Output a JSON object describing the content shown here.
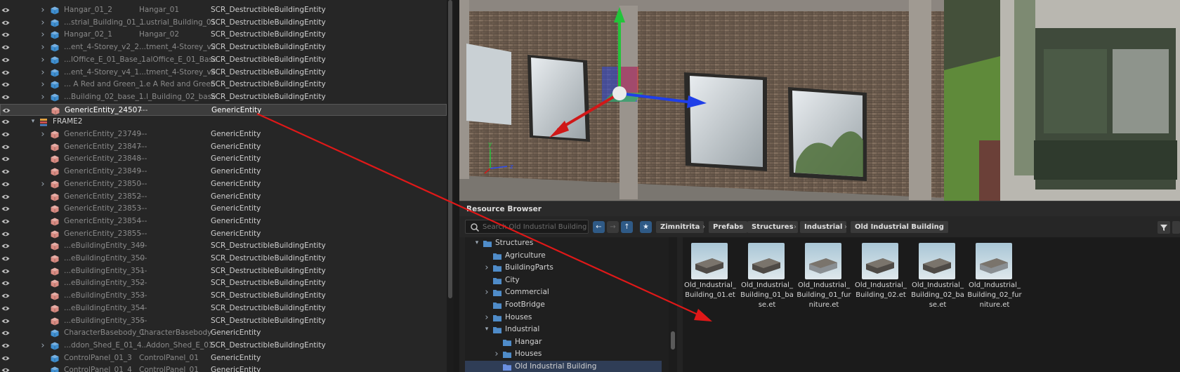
{
  "colors": {
    "accent_blue": "#2f5a86",
    "arrow_red": "#e01818",
    "entity_cube": "#d98b82",
    "prefab_cube": "#3f8fd1",
    "folder_blue": "#4f8cc9",
    "selection_row": "#3d3d3d"
  },
  "hierarchy": {
    "rows": [
      {
        "name": "Hangar_01_2",
        "prefab": "Hangar_01",
        "type": "SCR_DestructibleBuildingEntity",
        "icon": "prefab-cube-icon",
        "expandable": true,
        "dim": true
      },
      {
        "name": "...strial_Building_01_1",
        "prefab": "...ustrial_Building_01",
        "type": "SCR_DestructibleBuildingEntity",
        "icon": "prefab-cube-icon",
        "expandable": true,
        "dim": true
      },
      {
        "name": "Hangar_02_1",
        "prefab": "Hangar_02",
        "type": "SCR_DestructibleBuildingEntity",
        "icon": "prefab-cube-icon",
        "expandable": true,
        "dim": true
      },
      {
        "name": "...ent_4-Storey_v2_2",
        "prefab": "...tment_4-Storey_v2",
        "type": "SCR_DestructibleBuildingEntity",
        "icon": "prefab-cube-icon",
        "expandable": true,
        "dim": true
      },
      {
        "name": "...lOffice_E_01_Base_1",
        "prefab": "...alOffice_E_01_Base",
        "type": "SCR_DestructibleBuildingEntity",
        "icon": "prefab-cube-icon",
        "expandable": true,
        "dim": true
      },
      {
        "name": "...ent_4-Storey_v4_1",
        "prefab": "...tment_4-Storey_v4",
        "type": "SCR_DestructibleBuildingEntity",
        "icon": "prefab-cube-icon",
        "expandable": true,
        "dim": true
      },
      {
        "name": "... A Red and Green_1",
        "prefab": "...e A Red and Green",
        "type": "SCR_DestructibleBuildingEntity",
        "icon": "prefab-cube-icon",
        "expandable": true,
        "dim": true
      },
      {
        "name": "...Building_02_base_1",
        "prefab": "...l_Building_02_base",
        "type": "SCR_DestructibleBuildingEntity",
        "icon": "prefab-cube-icon",
        "expandable": true,
        "dim": true
      },
      {
        "name": "GenericEntity_24507",
        "prefab": "---",
        "type": "GenericEntity",
        "icon": "entity-cube-icon",
        "expandable": false,
        "dim": false,
        "selected": true
      },
      {
        "name": "FRAME2",
        "prefab": "",
        "type": "",
        "icon": "layer-icon",
        "expandable": true,
        "expanded": true,
        "dim": false,
        "layer": true
      },
      {
        "name": "GenericEntity_23749",
        "prefab": "---",
        "type": "GenericEntity",
        "icon": "entity-cube-icon",
        "expandable": true,
        "dim": true
      },
      {
        "name": "GenericEntity_23847",
        "prefab": "---",
        "type": "GenericEntity",
        "icon": "entity-cube-icon",
        "expandable": false,
        "dim": true
      },
      {
        "name": "GenericEntity_23848",
        "prefab": "---",
        "type": "GenericEntity",
        "icon": "entity-cube-icon",
        "expandable": false,
        "dim": true
      },
      {
        "name": "GenericEntity_23849",
        "prefab": "---",
        "type": "GenericEntity",
        "icon": "entity-cube-icon",
        "expandable": false,
        "dim": true
      },
      {
        "name": "GenericEntity_23850",
        "prefab": "---",
        "type": "GenericEntity",
        "icon": "entity-cube-icon",
        "expandable": true,
        "dim": true
      },
      {
        "name": "GenericEntity_23852",
        "prefab": "---",
        "type": "GenericEntity",
        "icon": "entity-cube-icon",
        "expandable": false,
        "dim": true
      },
      {
        "name": "GenericEntity_23853",
        "prefab": "---",
        "type": "GenericEntity",
        "icon": "entity-cube-icon",
        "expandable": false,
        "dim": true
      },
      {
        "name": "GenericEntity_23854",
        "prefab": "---",
        "type": "GenericEntity",
        "icon": "entity-cube-icon",
        "expandable": false,
        "dim": true
      },
      {
        "name": "GenericEntity_23855",
        "prefab": "---",
        "type": "GenericEntity",
        "icon": "entity-cube-icon",
        "expandable": false,
        "dim": true
      },
      {
        "name": "...eBuildingEntity_349",
        "prefab": "---",
        "type": "SCR_DestructibleBuildingEntity",
        "icon": "entity-cube-icon",
        "expandable": false,
        "dim": true
      },
      {
        "name": "...eBuildingEntity_350",
        "prefab": "---",
        "type": "SCR_DestructibleBuildingEntity",
        "icon": "entity-cube-icon",
        "expandable": false,
        "dim": true
      },
      {
        "name": "...eBuildingEntity_351",
        "prefab": "---",
        "type": "SCR_DestructibleBuildingEntity",
        "icon": "entity-cube-icon",
        "expandable": false,
        "dim": true
      },
      {
        "name": "...eBuildingEntity_352",
        "prefab": "---",
        "type": "SCR_DestructibleBuildingEntity",
        "icon": "entity-cube-icon",
        "expandable": false,
        "dim": true
      },
      {
        "name": "...eBuildingEntity_353",
        "prefab": "---",
        "type": "SCR_DestructibleBuildingEntity",
        "icon": "entity-cube-icon",
        "expandable": false,
        "dim": true
      },
      {
        "name": "...eBuildingEntity_354",
        "prefab": "---",
        "type": "SCR_DestructibleBuildingEntity",
        "icon": "entity-cube-icon",
        "expandable": false,
        "dim": true
      },
      {
        "name": "...eBuildingEntity_355",
        "prefab": "---",
        "type": "SCR_DestructibleBuildingEntity",
        "icon": "entity-cube-icon",
        "expandable": false,
        "dim": true
      },
      {
        "name": "CharacterBasebody_1",
        "prefab": "CharacterBasebody",
        "type": "GenericEntity",
        "icon": "prefab-cube-icon",
        "expandable": false,
        "dim": true
      },
      {
        "name": "...ddon_Shed_E_01_4",
        "prefab": "...Addon_Shed_E_01",
        "type": "SCR_DestructibleBuildingEntity",
        "icon": "prefab-cube-icon",
        "expandable": true,
        "dim": true
      },
      {
        "name": "ControlPanel_01_3",
        "prefab": "ControlPanel_01",
        "type": "GenericEntity",
        "icon": "prefab-cube-icon",
        "expandable": false,
        "dim": true
      },
      {
        "name": "ControlPanel_01_4",
        "prefab": "ControlPanel_01",
        "type": "GenericEntity",
        "icon": "prefab-cube-icon",
        "expandable": false,
        "dim": true
      }
    ]
  },
  "viewport": {
    "axis_labels": {
      "y": "y",
      "z": "z"
    }
  },
  "resource_browser": {
    "title": "Resource Browser",
    "search_placeholder": "Search Old Industrial Building",
    "breadcrumbs": [
      "Zimnitrita",
      "Prefabs",
      "Structures",
      "Industrial",
      "Old Industrial Building"
    ],
    "tree": [
      {
        "label": "Structures",
        "depth": 0,
        "expander": "down"
      },
      {
        "label": "Agriculture",
        "depth": 1,
        "expander": "none"
      },
      {
        "label": "BuildingParts",
        "depth": 1,
        "expander": "right"
      },
      {
        "label": "City",
        "depth": 1,
        "expander": "none"
      },
      {
        "label": "Commercial",
        "depth": 1,
        "expander": "right"
      },
      {
        "label": "FootBridge",
        "depth": 1,
        "expander": "none"
      },
      {
        "label": "Houses",
        "depth": 1,
        "expander": "right"
      },
      {
        "label": "Industrial",
        "depth": 1,
        "expander": "down"
      },
      {
        "label": "Hangar",
        "depth": 2,
        "expander": "none"
      },
      {
        "label": "Houses",
        "depth": 2,
        "expander": "right"
      },
      {
        "label": "Old Industrial Building",
        "depth": 2,
        "expander": "none",
        "selected": true
      }
    ],
    "assets": [
      {
        "label": "Old_Industrial_Building_01.et",
        "lines": [
          "Old_Industrial_",
          "Building_01.et"
        ]
      },
      {
        "label": "Old_Industrial_Building_01_base.et",
        "lines": [
          "Old_Industrial_",
          "Building_01_ba",
          "se.et"
        ]
      },
      {
        "label": "Old_Industrial_Building_01_furniture.et",
        "lines": [
          "Old_Industrial_",
          "Building_01_fur",
          "niture.et"
        ]
      },
      {
        "label": "Old_Industrial_Building_02.et",
        "lines": [
          "Old_Industrial_",
          "Building_02.et"
        ]
      },
      {
        "label": "Old_Industrial_Building_02_base.et",
        "lines": [
          "Old_Industrial_",
          "Building_02_ba",
          "se.et"
        ]
      },
      {
        "label": "Old_Industrial_Building_02_furniture.et",
        "lines": [
          "Old_Industrial_",
          "Building_02_fur",
          "niture.et"
        ]
      }
    ]
  }
}
